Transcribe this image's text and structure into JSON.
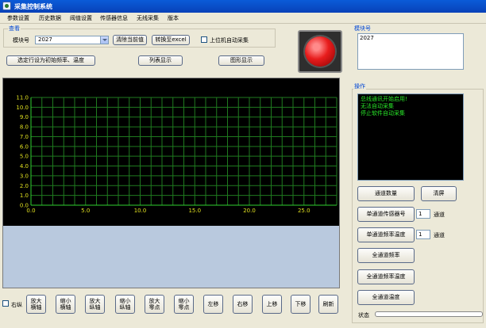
{
  "window": {
    "title": "采集控制系统"
  },
  "menu": [
    "参数设置",
    "历史数据",
    "阈值设置",
    "传感器信息",
    "无线采集",
    "版本"
  ],
  "view_group": {
    "label": "查看",
    "module_label": "模块号",
    "module_value": "2027",
    "clear_button": "清除当前值",
    "excel_button": "转换至excel",
    "auto_collect_label": "上位机自动采集",
    "auto_collect_checked": false,
    "init_button": "选定行设为初始频率、温度",
    "list_button": "列表显示",
    "graph_button": "图形显示"
  },
  "module_group": {
    "label": "模块号",
    "items": [
      "2027"
    ]
  },
  "ops_group": {
    "label": "操作",
    "log_lines": [
      "总线通讯开始启用!",
      "无法自动采集",
      "停止软件自动采集"
    ],
    "channel_count_button": "通道数量",
    "clear_screen_button": "清屏",
    "single_sensor_button": "单通道传感器号",
    "single_sensor_value": "1",
    "single_sensor_unit": "通道",
    "single_freq_temp_button": "单通道频率温度",
    "single_freq_temp_value": "1",
    "single_freq_temp_unit": "通道",
    "all_freq_button": "全通道频率",
    "all_freq_temp_button": "全通道频率温度",
    "all_temp_button": "全通道温度",
    "status_label": "状态"
  },
  "bottom_controls": {
    "right_axis_label": "右纵",
    "right_axis_checked": false,
    "buttons": [
      "放大\n横轴",
      "缩小\n横轴",
      "放大\n纵轴",
      "缩小\n纵轴",
      "放大\n零点",
      "缩小\n零点",
      "左移",
      "右移",
      "上移",
      "下移",
      "刷新"
    ]
  },
  "chart_data": {
    "type": "line",
    "series": [],
    "xlim": [
      0,
      28
    ],
    "ylim": [
      0,
      11
    ],
    "x_ticks": [
      "0.0",
      "5.0",
      "10.0",
      "15.0",
      "20.0",
      "25.0"
    ],
    "y_ticks": [
      "0.0",
      "1.0",
      "2.0",
      "3.0",
      "4.0",
      "5.0",
      "6.0",
      "7.0",
      "8.0",
      "9.0",
      "10.0",
      "11.0"
    ],
    "grid": true,
    "background_color": "#000000",
    "grid_color": "#1f7a1f",
    "axis_color": "#2fd12f",
    "label_color": "#e0e020"
  },
  "colors": {
    "accent": "#0a5bd8",
    "log_text": "#28e828",
    "alarm": "#e81d1d"
  }
}
